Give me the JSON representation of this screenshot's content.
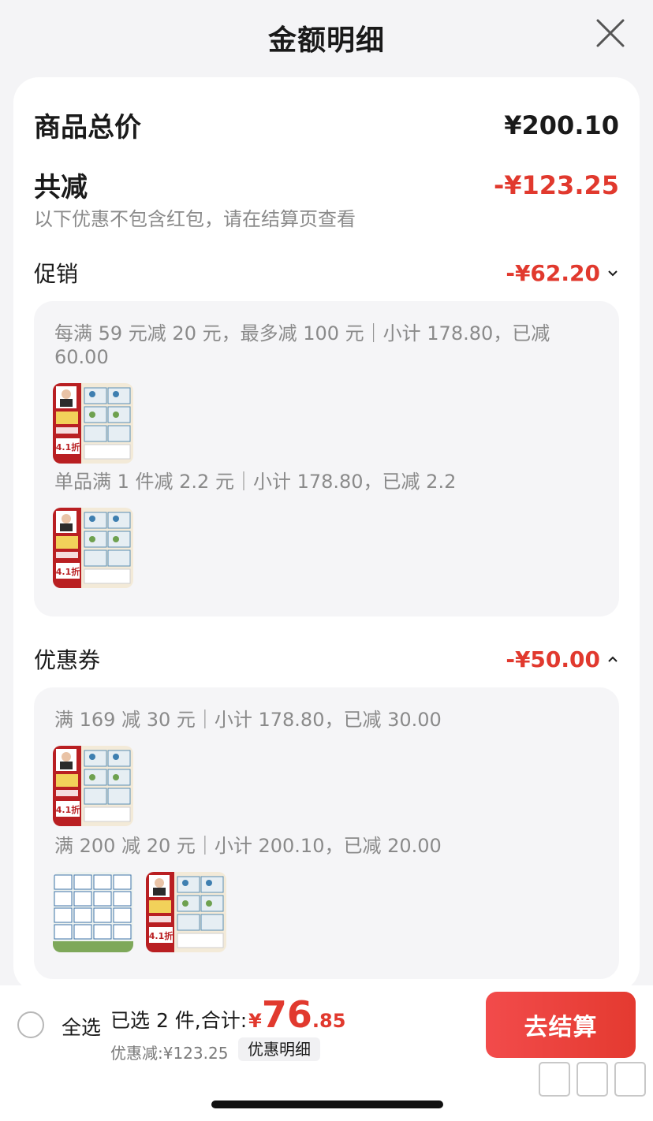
{
  "header": {
    "title": "金额明细"
  },
  "summary": {
    "total_label": "商品总价",
    "total_value": "¥200.10",
    "reduce_label": "共减",
    "reduce_value": "-¥123.25",
    "note": "以下优惠不包含红包，请在结算页查看"
  },
  "promotion": {
    "title": "促销",
    "amount": "-¥62.20",
    "rules": [
      {
        "text": "每满 59 元减 20 元，最多减 100 元｜小计 178.80，已减 60.00"
      },
      {
        "text": "单品满 1 件减 2.2 元｜小计 178.80，已减 2.2"
      }
    ],
    "badge_text": "4.1折"
  },
  "coupon": {
    "title": "优惠券",
    "amount": "-¥50.00",
    "rules": [
      {
        "text": "满 169 减 30 元｜小计 178.80，已减 30.00"
      },
      {
        "text": "满 200 减 20 元｜小计 200.10，已减 20.00"
      }
    ]
  },
  "bottom": {
    "select_all": "全选",
    "selected_text": "已选 2 件,合计:",
    "price_symbol": "¥",
    "price_int": "76",
    "price_dec": ".85",
    "discount_text": "优惠减:¥123.25",
    "detail_chip": "优惠明细",
    "checkout": "去结算"
  },
  "colors": {
    "accent": "#e1392e",
    "button": "#e43a30"
  }
}
